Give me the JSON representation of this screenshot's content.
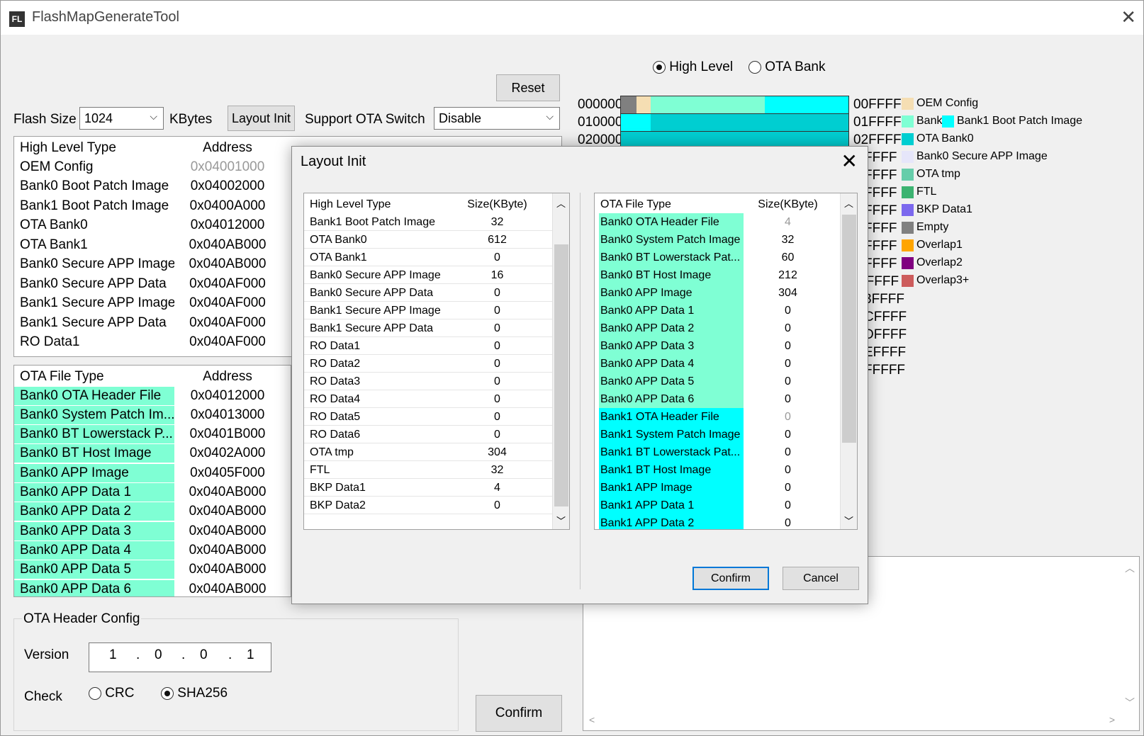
{
  "window": {
    "title": "FlashMapGenerateTool",
    "icon": "FL"
  },
  "top": {
    "reset_label": "Reset",
    "flash_size_label": "Flash Size",
    "flash_size_value": "1024",
    "kbytes_label": "KBytes",
    "layout_init_label": "Layout Init",
    "ota_switch_label": "Support OTA Switch",
    "ota_switch_value": "Disable"
  },
  "high_level_table": {
    "headers": [
      "High Level Type",
      "Address"
    ],
    "rows": [
      [
        "OEM Config",
        "0x04001000"
      ],
      [
        "Bank0 Boot Patch Image",
        "0x04002000"
      ],
      [
        "Bank1 Boot Patch Image",
        "0x0400A000"
      ],
      [
        "OTA Bank0",
        "0x04012000"
      ],
      [
        "OTA Bank1",
        "0x040AB000"
      ],
      [
        "Bank0 Secure APP Image",
        "0x040AB000"
      ],
      [
        "Bank0 Secure APP Data",
        "0x040AF000"
      ],
      [
        "Bank1 Secure APP Image",
        "0x040AF000"
      ],
      [
        "Bank1 Secure APP Data",
        "0x040AF000"
      ],
      [
        "RO Data1",
        "0x040AF000"
      ]
    ]
  },
  "ota_table": {
    "headers": [
      "OTA File Type",
      "Address"
    ],
    "rows": [
      [
        "Bank0 OTA Header File",
        "0x04012000"
      ],
      [
        "Bank0 System Patch Im...",
        "0x04013000"
      ],
      [
        "Bank0 BT Lowerstack P...",
        "0x0401B000"
      ],
      [
        "Bank0 BT Host Image",
        "0x0402A000"
      ],
      [
        "Bank0 APP Image",
        "0x0405F000"
      ],
      [
        "Bank0 APP Data 1",
        "0x040AB000"
      ],
      [
        "Bank0 APP Data 2",
        "0x040AB000"
      ],
      [
        "Bank0 APP Data 3",
        "0x040AB000"
      ],
      [
        "Bank0 APP Data 4",
        "0x040AB000"
      ],
      [
        "Bank0 APP Data 5",
        "0x040AB000"
      ],
      [
        "Bank0 APP Data 6",
        "0x040AB000"
      ]
    ]
  },
  "ota_header_config": {
    "title": "OTA Header Config",
    "version_label": "Version",
    "version": [
      "1",
      "0",
      "0",
      "1"
    ],
    "check_label": "Check",
    "crc_label": "CRC",
    "sha_label": "SHA256",
    "selected": "SHA256"
  },
  "confirm_main_label": "Confirm",
  "view_mode": {
    "high_level_label": "High Level",
    "ota_bank_label": "OTA Bank",
    "selected": "High Level"
  },
  "map": {
    "left_labels": [
      "000000",
      "010000",
      "020000"
    ],
    "right_labels": [
      "00FFFF",
      "01FFFF",
      "02FFFF",
      "FFFF",
      "FFFF",
      "FFFF",
      "FFFF",
      "FFFF",
      "FFFF",
      "FFFF",
      "AFFFF",
      "3FFFF",
      "CFFFF",
      "DFFFF",
      "EFFFF",
      "FFFFF"
    ]
  },
  "legend": [
    {
      "label": "OEM Config",
      "color": "#f5deb3"
    },
    {
      "label": "Bank",
      "color": "#7fffd4"
    },
    {
      "label": "Bank1 Boot Patch Image",
      "color": "#00ffff"
    },
    {
      "label": "OTA Bank0",
      "color": "#00ced1"
    },
    {
      "label": "Bank0 Secure APP Image",
      "color": "#e6e6fa"
    },
    {
      "label": "OTA tmp",
      "color": "#66cdaa"
    },
    {
      "label": "FTL",
      "color": "#3cb371"
    },
    {
      "label": "BKP Data1",
      "color": "#7b68ee"
    },
    {
      "label": "Empty",
      "color": "#808080"
    },
    {
      "label": "Overlap1",
      "color": "#ffa500"
    },
    {
      "label": "Overlap2",
      "color": "#800080"
    },
    {
      "label": "Overlap3+",
      "color": "#cd5c5c"
    }
  ],
  "dialog": {
    "title": "Layout Init",
    "left_headers": [
      "High Level Type",
      "Size(KByte)"
    ],
    "left_rows": [
      [
        "Bank1 Boot Patch Image",
        "32"
      ],
      [
        "OTA Bank0",
        "612"
      ],
      [
        "OTA Bank1",
        "0"
      ],
      [
        "Bank0 Secure APP Image",
        "16"
      ],
      [
        "Bank0 Secure APP Data",
        "0"
      ],
      [
        "Bank1 Secure APP Image",
        "0"
      ],
      [
        "Bank1 Secure APP Data",
        "0"
      ],
      [
        "RO Data1",
        "0"
      ],
      [
        "RO Data2",
        "0"
      ],
      [
        "RO Data3",
        "0"
      ],
      [
        "RO Data4",
        "0"
      ],
      [
        "RO Data5",
        "0"
      ],
      [
        "RO Data6",
        "0"
      ],
      [
        "OTA tmp",
        "304"
      ],
      [
        "FTL",
        "32"
      ],
      [
        "BKP Data1",
        "4"
      ],
      [
        "BKP Data2",
        "0"
      ]
    ],
    "right_headers": [
      "OTA File Type",
      "Size(KByte)"
    ],
    "right_rows": [
      [
        "Bank0 OTA Header File",
        "4",
        "green"
      ],
      [
        "Bank0 System Patch Image",
        "32",
        "green"
      ],
      [
        "Bank0 BT Lowerstack Pat...",
        "60",
        "green"
      ],
      [
        "Bank0 BT Host Image",
        "212",
        "green"
      ],
      [
        "Bank0 APP Image",
        "304",
        "green"
      ],
      [
        "Bank0 APP Data 1",
        "0",
        "green"
      ],
      [
        "Bank0 APP Data 2",
        "0",
        "green"
      ],
      [
        "Bank0 APP Data 3",
        "0",
        "green"
      ],
      [
        "Bank0 APP Data 4",
        "0",
        "green"
      ],
      [
        "Bank0 APP Data 5",
        "0",
        "green"
      ],
      [
        "Bank0 APP Data 6",
        "0",
        "green"
      ],
      [
        "Bank1 OTA Header File",
        "0",
        "cyan"
      ],
      [
        "Bank1 System Patch Image",
        "0",
        "cyan"
      ],
      [
        "Bank1 BT Lowerstack Pat...",
        "0",
        "cyan"
      ],
      [
        "Bank1 BT Host Image",
        "0",
        "cyan"
      ],
      [
        "Bank1 APP Image",
        "0",
        "cyan"
      ],
      [
        "Bank1 APP Data 1",
        "0",
        "cyan"
      ],
      [
        "Bank1 APP Data 2",
        "0",
        "cyan"
      ]
    ],
    "confirm_label": "Confirm",
    "cancel_label": "Cancel"
  }
}
